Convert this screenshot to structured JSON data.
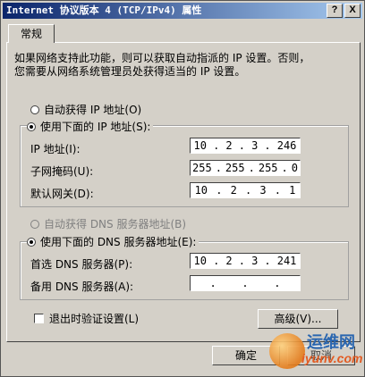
{
  "window": {
    "title": "Internet 协议版本 4 (TCP/IPv4) 属性",
    "help_label": "?",
    "close_label": "X"
  },
  "tabs": [
    {
      "label": "常规"
    }
  ],
  "intro": {
    "line1": "如果网络支持此功能，则可以获取自动指派的 IP 设置。否则，",
    "line2": "您需要从网络系统管理员处获得适当的 IP 设置。"
  },
  "ip_section": {
    "auto_label": "自动获得 IP 地址(O)",
    "manual_label": "使用下面的 IP 地址(S):",
    "ip_label": "IP 地址(I):",
    "mask_label": "子网掩码(U):",
    "gateway_label": "默认网关(D):",
    "ip": [
      "10",
      "2",
      "3",
      "246"
    ],
    "mask": [
      "255",
      "255",
      "255",
      "0"
    ],
    "gateway": [
      "10",
      "2",
      "3",
      "1"
    ]
  },
  "dns_section": {
    "auto_label": "自动获得 DNS 服务器地址(B)",
    "manual_label": "使用下面的 DNS 服务器地址(E):",
    "preferred_label": "首选 DNS 服务器(P):",
    "alternate_label": "备用 DNS 服务器(A):",
    "preferred": [
      "10",
      "2",
      "3",
      "241"
    ],
    "alternate": [
      "",
      "",
      "",
      ""
    ]
  },
  "footer": {
    "validate_label": "退出时验证设置(L)",
    "advanced_label": "高级(V)...",
    "ok_label": "确定",
    "cancel_label": "取消"
  },
  "watermark": {
    "cn": "运维网",
    "url": "iyunv.com"
  }
}
